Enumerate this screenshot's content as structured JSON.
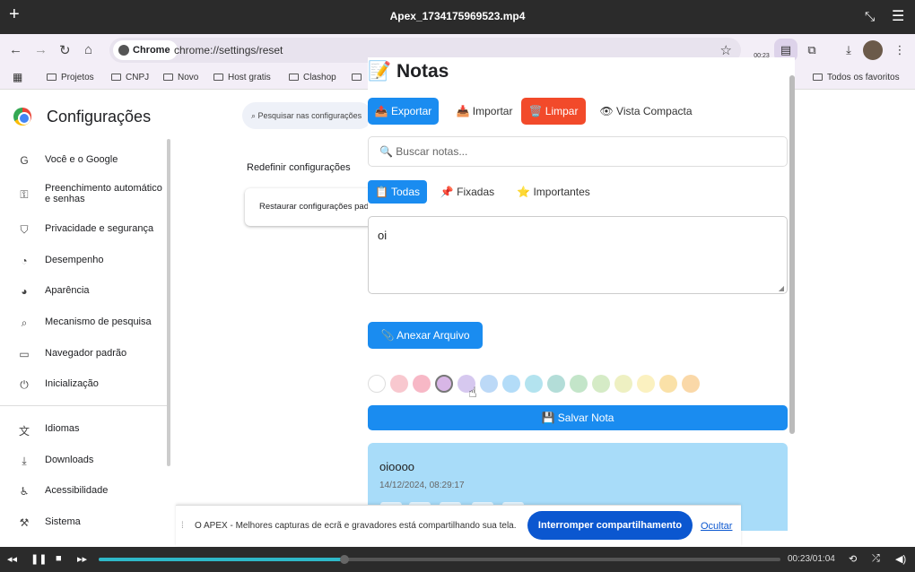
{
  "player": {
    "title": "Apex_1734175969523.mp4",
    "time": "00:23/01:04",
    "progress": 0.36
  },
  "browser": {
    "site_chip": "Chrome",
    "url": "chrome://settings/reset",
    "ext_badge": "00:23",
    "bookmarks": [
      "Projetos",
      "CNPJ",
      "Novo",
      "Host gratis",
      "Clashop",
      "Todos os favoritos"
    ]
  },
  "settings": {
    "title": "Configurações",
    "search_placeholder": "Pesquisar nas configurações",
    "reset_heading": "Redefinir configurações",
    "reset_card": "Restaurar configurações padrão",
    "sidebar": [
      {
        "icon": "google-icon",
        "glyph": "G",
        "label": "Você e o Google"
      },
      {
        "icon": "key-icon",
        "glyph": "⚿",
        "label": "Preenchimento automático e senhas"
      },
      {
        "icon": "shield-icon",
        "glyph": "⛉",
        "label": "Privacidade e segurança"
      },
      {
        "icon": "gauge-icon",
        "glyph": "◔",
        "label": "Desempenho"
      },
      {
        "icon": "palette-icon",
        "glyph": "◕",
        "label": "Aparência"
      },
      {
        "icon": "search-icon",
        "glyph": "⌕",
        "label": "Mecanismo de pesquisa"
      },
      {
        "icon": "browser-icon",
        "glyph": "▭",
        "label": "Navegador padrão"
      },
      {
        "icon": "power-icon",
        "glyph": "⏻",
        "label": "Inicialização"
      },
      {
        "icon": "language-icon",
        "glyph": "文",
        "label": "Idiomas"
      },
      {
        "icon": "download-icon",
        "glyph": "⤓",
        "label": "Downloads"
      },
      {
        "icon": "accessibility-icon",
        "glyph": "♿",
        "label": "Acessibilidade"
      },
      {
        "icon": "wrench-icon",
        "glyph": "⚒",
        "label": "Sistema"
      }
    ]
  },
  "notes": {
    "title": "📝 Notas",
    "toolbar": {
      "export": "📤 Exportar",
      "import": "📥 Importar",
      "clear": "🗑️ Limpar",
      "compact": "👁 Vista Compacta"
    },
    "search_placeholder": "🔍 Buscar notas...",
    "tabs": {
      "all": "📋 Todas",
      "pinned": "📌 Fixadas",
      "important": "⭐ Importantes"
    },
    "note_text": "oi",
    "attach": "📎 Anexar Arquivo",
    "colors": [
      "#ffffff",
      "#f8c8cf",
      "#f7b8c6",
      "#d8b6e6",
      "#d6c8ef",
      "#bcd9f7",
      "#b3dcf8",
      "#b3e3ef",
      "#b3ddd8",
      "#c3e5c9",
      "#d5ebc6",
      "#eef0c2",
      "#fbf1c0",
      "#fae1a8",
      "#fad8a8"
    ],
    "save": "💾 Salvar Nota",
    "card": {
      "title": "oioooo",
      "date": "14/12/2024, 08:29:17",
      "color": "#a8dcf9"
    }
  },
  "share_bar": {
    "message": "O APEX - Melhores capturas de ecrã e gravadores está compartilhando sua tela.",
    "stop": "Interromper compartilhamento",
    "hide": "Ocultar"
  }
}
